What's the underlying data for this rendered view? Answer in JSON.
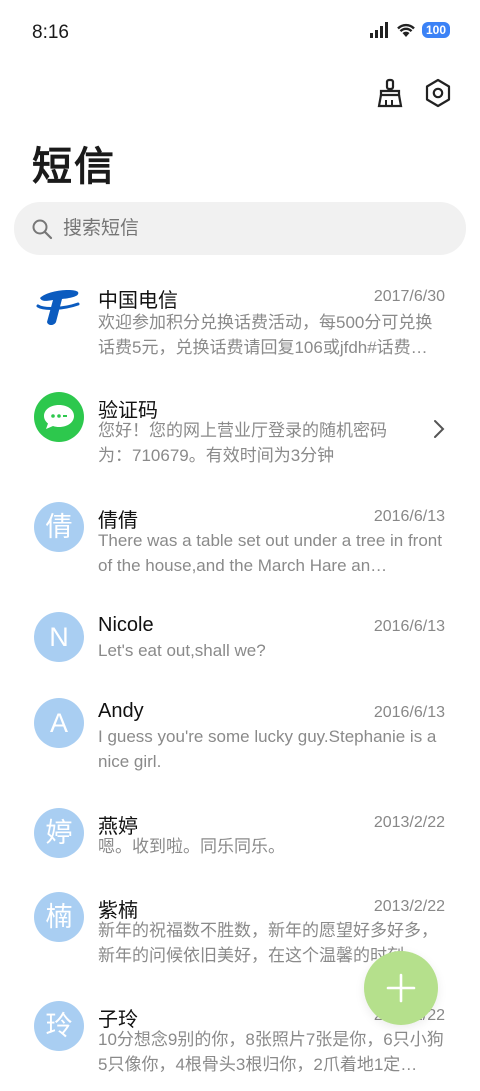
{
  "status_bar": {
    "time": "8:16",
    "battery": "100"
  },
  "header": {
    "title": "短信"
  },
  "search": {
    "placeholder": "搜索短信"
  },
  "messages": [
    {
      "name": "中国电信",
      "date": "2017/6/30",
      "preview": "欢迎参加积分兑换话费活动，每500分可兑换话费5元，兑换话费请回复106或jfdh#话费…",
      "avatar": "telecom-logo"
    },
    {
      "name": "验证码",
      "date": "",
      "preview": "您好！您的网上营业厅登录的随机密码为：710679。有效时间为3分钟",
      "avatar": "message-bubble-icon"
    },
    {
      "name": "倩倩",
      "date": "2016/6/13",
      "preview": "There was a table set out under a tree in front of the house,and the March Hare an…",
      "avatar": "倩"
    },
    {
      "name": "Nicole",
      "date": "2016/6/13",
      "preview": "Let's eat out,shall we?",
      "avatar": "N"
    },
    {
      "name": "Andy",
      "date": "2016/6/13",
      "preview": "I guess you're some lucky guy.Stephanie is a nice girl.",
      "avatar": "A"
    },
    {
      "name": "燕婷",
      "date": "2013/2/22",
      "preview": "嗯。收到啦。同乐同乐。",
      "avatar": "婷"
    },
    {
      "name": "紫楠",
      "date": "2013/2/22",
      "preview": "新年的祝福数不胜数，新年的愿望好多好多，新年的问候依旧美好，在这个温馨的时刻…",
      "avatar": "楠"
    },
    {
      "name": "子玲",
      "date": "2013/2/22",
      "preview": "10分想念9别的你，8张照片7张是你，6只小狗5只像你，4根骨头3根归你，2爪着地1定…",
      "avatar": "玲"
    }
  ]
}
